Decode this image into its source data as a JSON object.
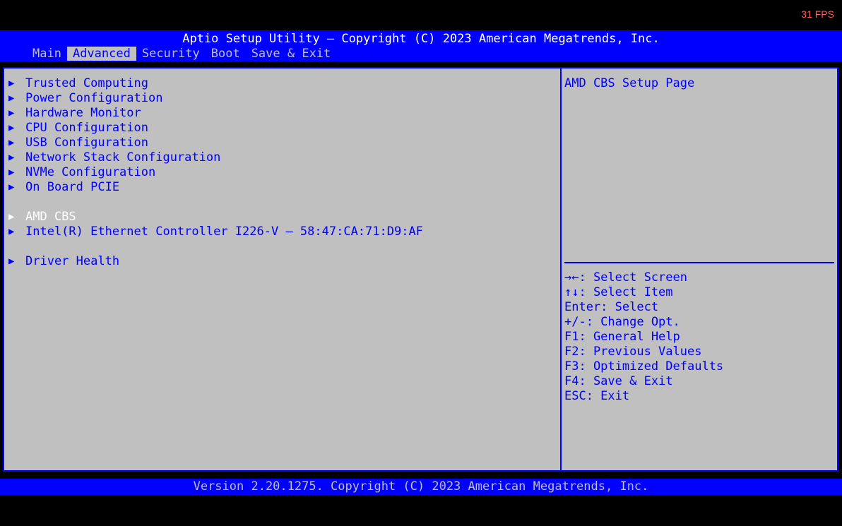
{
  "overlay": {
    "fps": "31 FPS"
  },
  "header": {
    "title": "Aptio Setup Utility – Copyright (C) 2023 American Megatrends, Inc.",
    "tabs": [
      "Main",
      "Advanced",
      "Security",
      "Boot",
      "Save & Exit"
    ],
    "active_tab": "Advanced"
  },
  "menu": {
    "items": [
      "Trusted Computing",
      "Power Configuration",
      "Hardware Monitor",
      "CPU Configuration",
      "USB Configuration",
      "Network Stack Configuration",
      "NVMe Configuration",
      "On Board PCIE",
      "AMD CBS",
      "Intel(R) Ethernet Controller I226-V – 58:47:CA:71:D9:AF",
      "Driver Health"
    ],
    "selected": "AMD CBS",
    "arrow_glyph": "▶"
  },
  "help": {
    "description": "AMD CBS Setup Page",
    "keys": [
      "→←: Select Screen",
      "↑↓: Select Item",
      "Enter: Select",
      "+/-: Change Opt.",
      "F1: General Help",
      "F2: Previous Values",
      "F3: Optimized Defaults",
      "F4: Save & Exit",
      "ESC: Exit"
    ]
  },
  "footer": {
    "version": "Version 2.20.1275. Copyright (C) 2023 American Megatrends, Inc."
  },
  "colors": {
    "bios_blue": "#0000ff",
    "panel_gray": "#c0c0c0",
    "selected_text": "#ffffff",
    "fps_red": "#ff6060"
  }
}
